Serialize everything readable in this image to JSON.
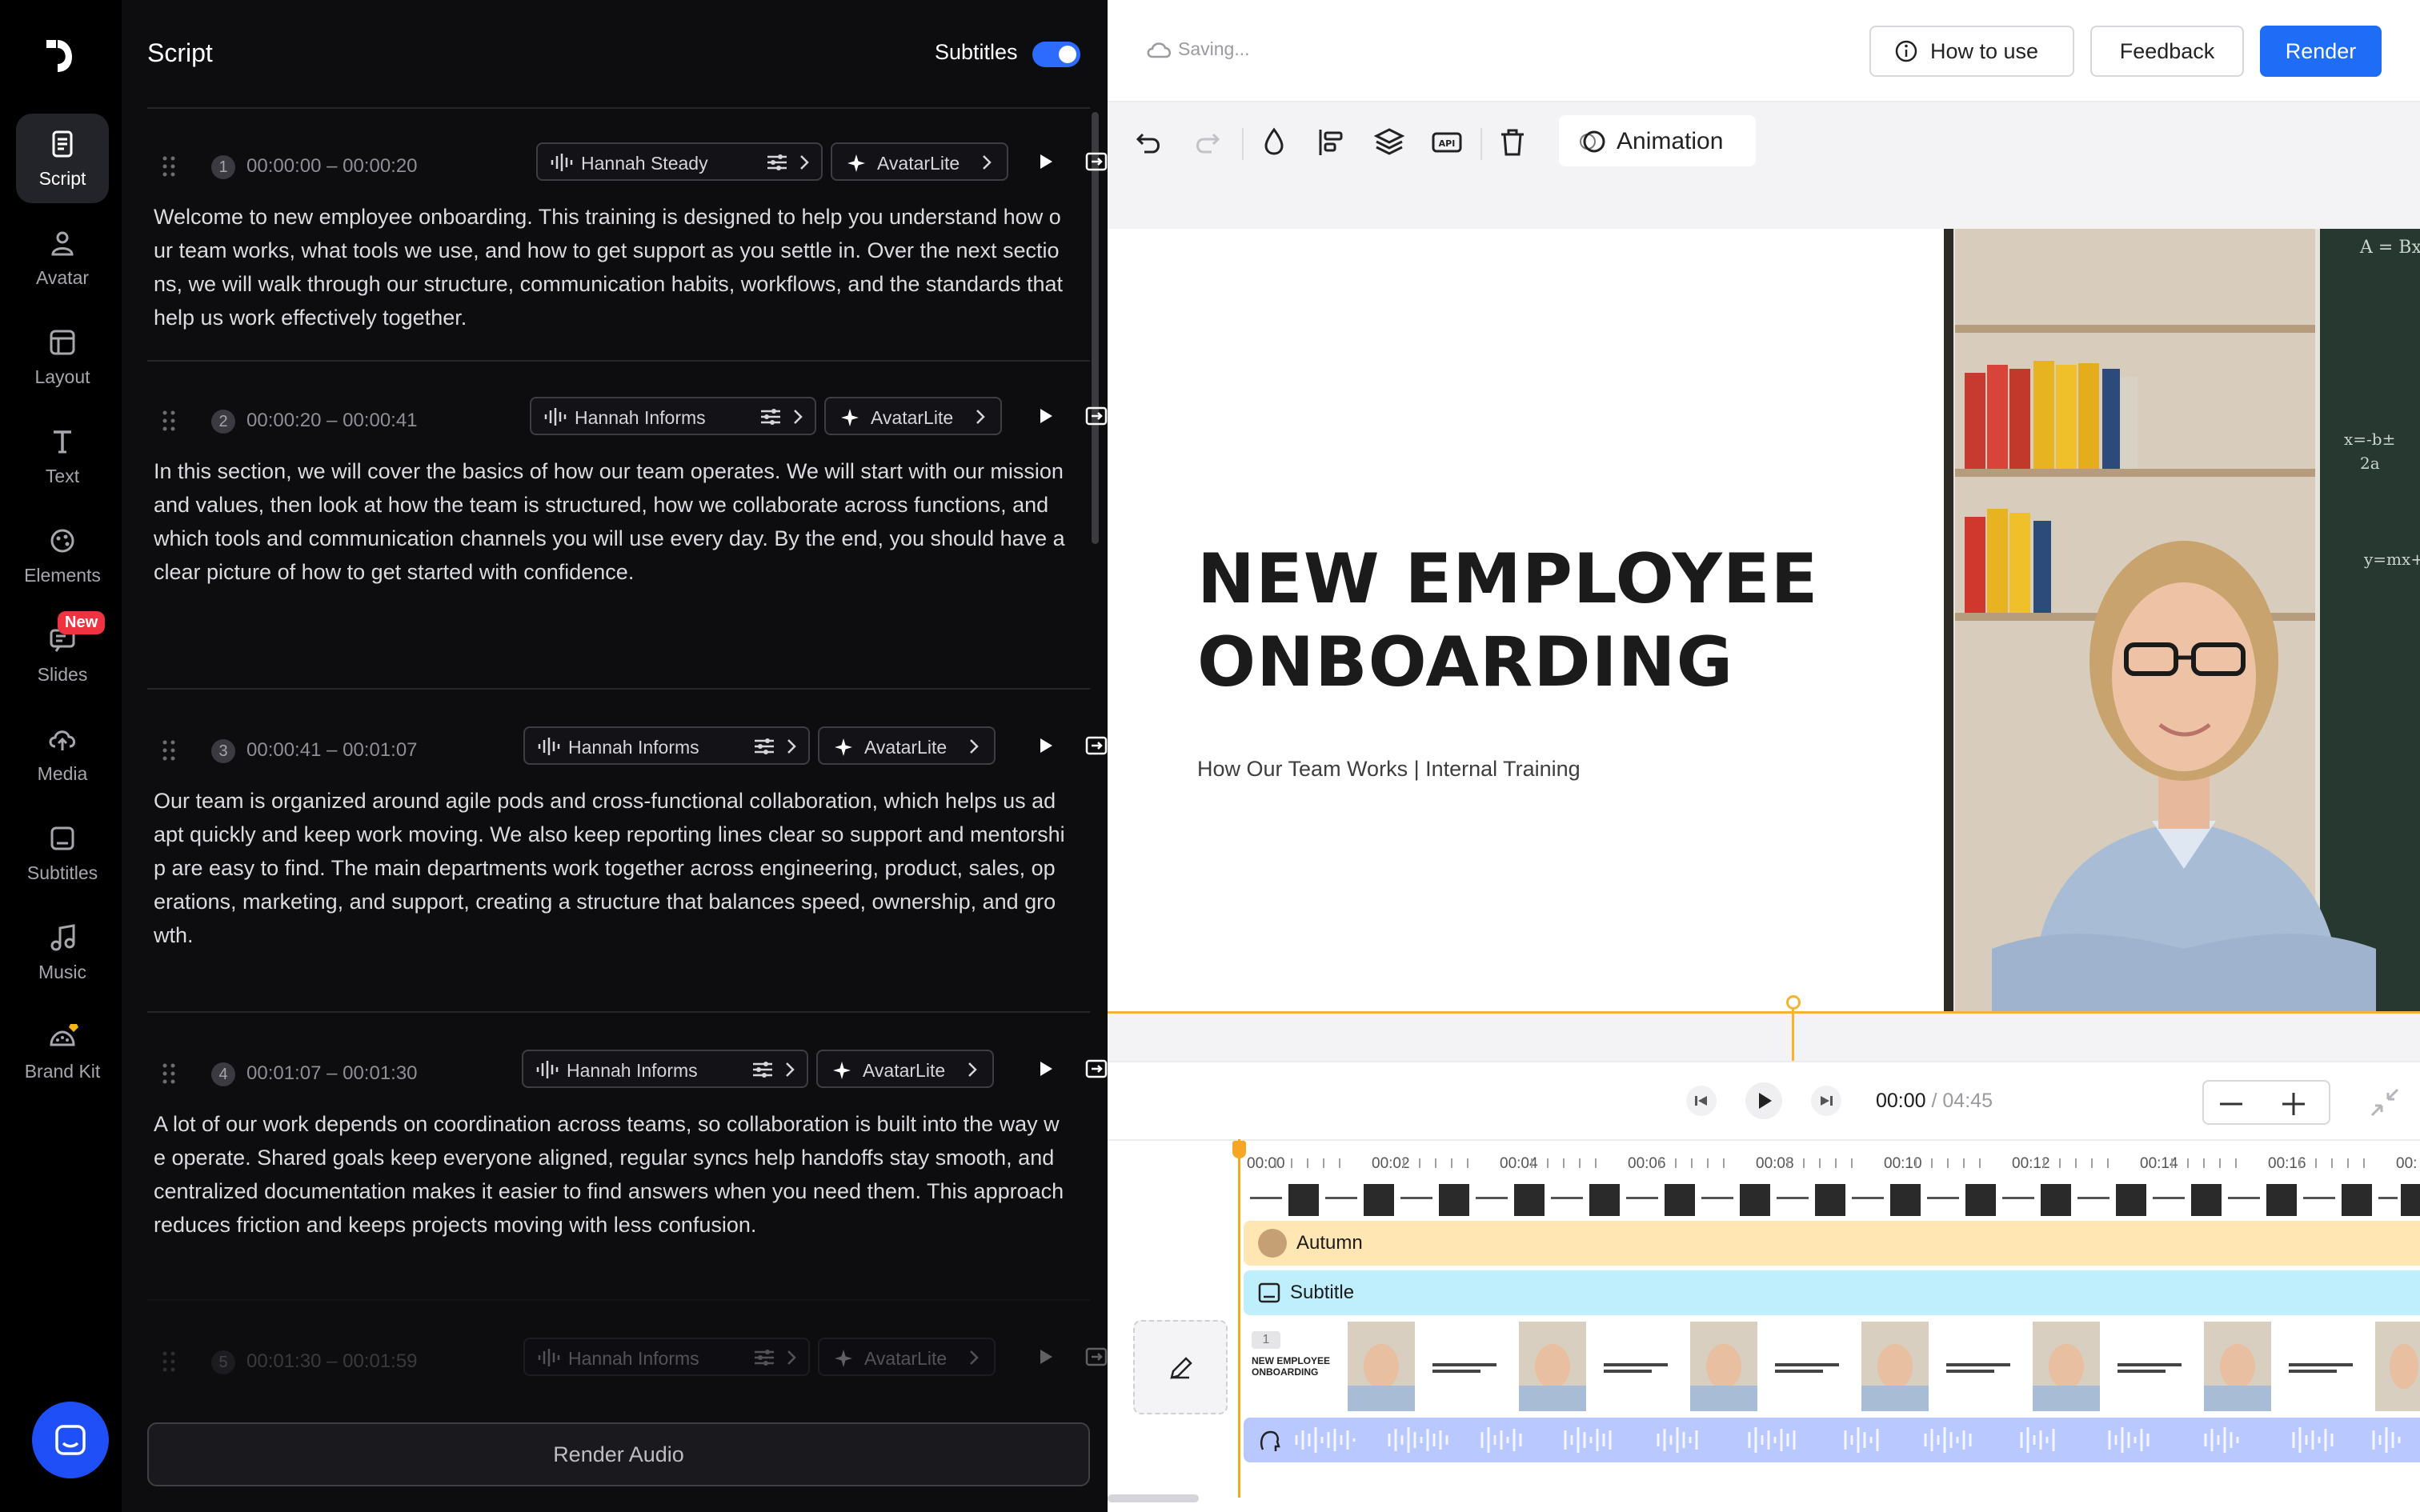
{
  "sidebar": {
    "items": [
      {
        "label": "Script",
        "icon": "script-icon",
        "active": true
      },
      {
        "label": "Avatar",
        "icon": "avatar-icon"
      },
      {
        "label": "Layout",
        "icon": "layout-icon"
      },
      {
        "label": "Text",
        "icon": "text-icon"
      },
      {
        "label": "Elements",
        "icon": "elements-icon"
      },
      {
        "label": "Slides",
        "icon": "slides-icon",
        "badge": "New"
      },
      {
        "label": "Media",
        "icon": "media-icon"
      },
      {
        "label": "Subtitles",
        "icon": "subtitles-icon"
      },
      {
        "label": "Music",
        "icon": "music-icon"
      },
      {
        "label": "Brand Kit",
        "icon": "brand-kit-icon"
      }
    ]
  },
  "script": {
    "title": "Script",
    "subtitles_label": "Subtitles",
    "subtitles_on": true,
    "render_audio_label": "Render Audio",
    "segments": [
      {
        "num": "1",
        "time": "00:00:00 – 00:00:20",
        "voice": "Hannah Steady",
        "avatar": "AvatarLite",
        "text": "Welcome to new employee onboarding. This training is designed to help you understand how our team works, what tools we use, and how to get support as you settle in. Over the next sections, we will walk through our structure, communication habits, workflows, and the standards that help us work effectively together."
      },
      {
        "num": "2",
        "time": "00:00:20 – 00:00:41",
        "voice": "Hannah Informs",
        "avatar": "AvatarLite",
        "text": "In this section, we will cover the basics of how our team operates. We will start with our mission and values, then look at how the team is structured, how we collaborate across functions, and which tools and communication channels you will use every day. By the end, you should have a clear picture of how to get started with confidence."
      },
      {
        "num": "3",
        "time": "00:00:41 – 00:01:07",
        "voice": "Hannah Informs",
        "avatar": "AvatarLite",
        "text": "Our team is organized around agile pods and cross-functional collaboration, which helps us adapt quickly and keep work moving. We also keep reporting lines clear so support and mentorship are easy to find. The main departments work together across engineering, product, sales, operations, marketing, and support, creating a structure that balances speed, ownership, and growth."
      },
      {
        "num": "4",
        "time": "00:01:07 – 00:01:30",
        "voice": "Hannah Informs",
        "avatar": "AvatarLite",
        "text": "A lot of our work depends on coordination across teams, so collaboration is built into the way we operate. Shared goals keep everyone aligned, regular syncs help handoffs stay smooth, and centralized documentation makes it easier to find answers when you need them. This approach reduces friction and keeps projects moving with less confusion."
      },
      {
        "num": "5",
        "time": "00:01:30 – 00:01:59",
        "voice": "Hannah Informs",
        "avatar": "AvatarLite",
        "text": ""
      }
    ]
  },
  "topbar": {
    "status": "Saving...",
    "how_to_use": "How to use",
    "feedback": "Feedback",
    "render": "Render"
  },
  "toolbar": {
    "animation": "Animation"
  },
  "slide": {
    "title_line1": "NEW EMPLOYEE",
    "title_line2": "ONBOARDING",
    "subtitle": "How Our Team Works | Internal Training"
  },
  "timeline": {
    "current": "00:00",
    "total": "/ 04:45",
    "ruler": [
      "00:00",
      "00:02",
      "00:04",
      "00:06",
      "00:08",
      "00:10",
      "00:12",
      "00:14",
      "00:16",
      "00:"
    ],
    "avatar_track": "Autumn",
    "subtitle_track": "Subtitle",
    "scene_num": "1",
    "scene_title": "NEW EMPLOYEE ONBOARDING"
  },
  "colors": {
    "accent": "#1f6df7",
    "playhead": "#f5a623",
    "avatar_track": "#ffe6b3",
    "subtitle_track": "#bfeefd",
    "audio_track": "#b9c8ff"
  }
}
